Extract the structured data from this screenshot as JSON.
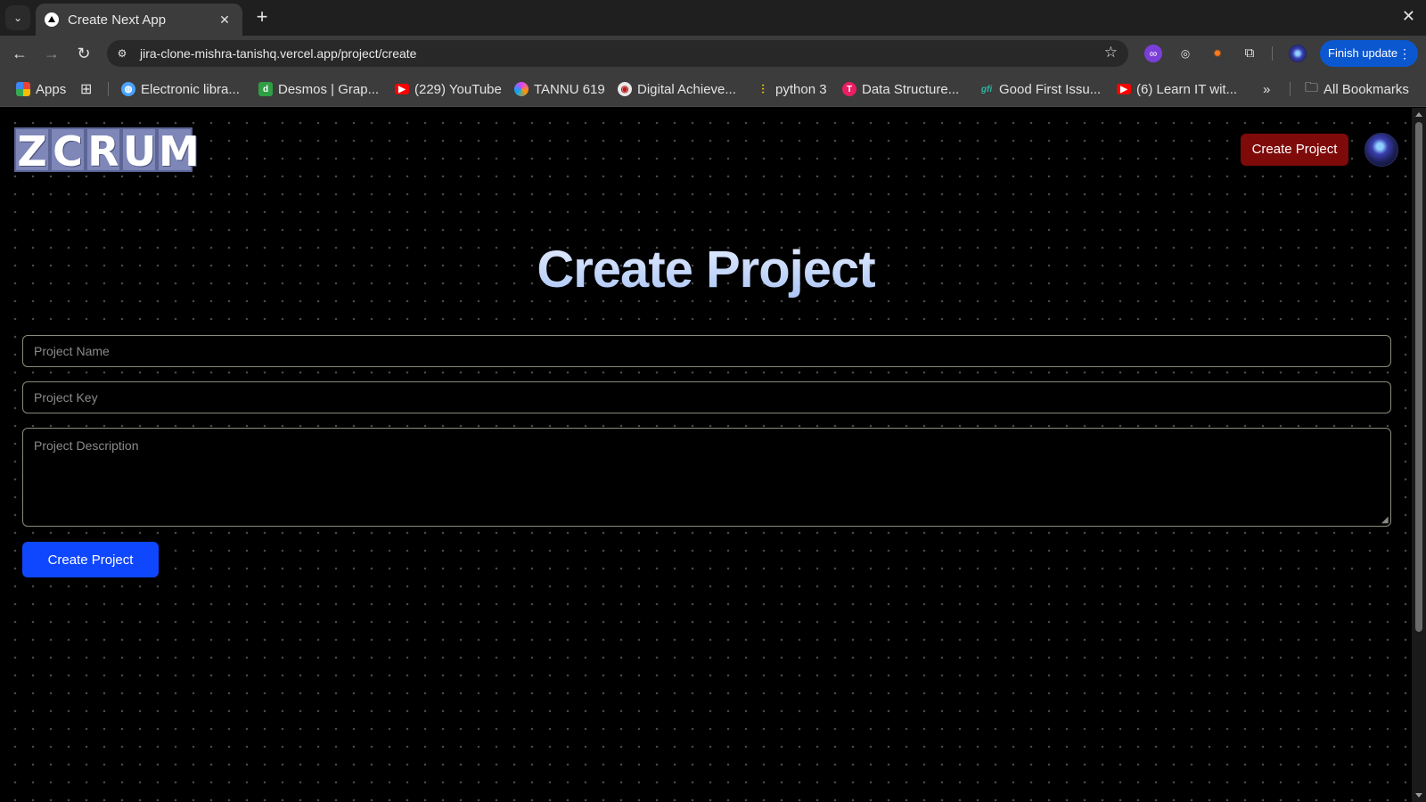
{
  "browser": {
    "tab_title": "Create Next App",
    "tab_close": "✕",
    "new_tab": "+",
    "window_close": "✕",
    "tab_search": "⌄",
    "url": "jira-clone-mishra-tanishq.vercel.app/project/create",
    "finish_update": "Finish update",
    "kebab": "⋮",
    "back": "←",
    "forward": "→",
    "reload": "↻",
    "star": "☆"
  },
  "bookmarks": {
    "apps": "Apps",
    "items": [
      {
        "label": "Electronic libra...",
        "icon": "globe-icon",
        "color": "#4aa3ff"
      },
      {
        "label": "Desmos | Grap...",
        "icon": "desmos-icon",
        "color": "#2f9e44"
      },
      {
        "label": "(229) YouTube",
        "icon": "youtube-icon",
        "color": "#ff0000"
      },
      {
        "label": "TANNU 619",
        "icon": "swirl-icon",
        "color": "#e040fb"
      },
      {
        "label": "Digital Achieve...",
        "icon": "badge-icon",
        "color": "#e8e8e8"
      },
      {
        "label": "python 3",
        "icon": "bars-icon",
        "color": "#f5c400"
      },
      {
        "label": "Data Structure...",
        "icon": "brand-icon",
        "color": "#e91e63"
      },
      {
        "label": "Good First Issu...",
        "icon": "gfi-icon",
        "color": "#2bb5a3"
      },
      {
        "label": "(6) Learn IT wit...",
        "icon": "youtube-icon",
        "color": "#ff0000"
      }
    ],
    "more": "»",
    "all_bookmarks": "All Bookmarks"
  },
  "header": {
    "logo_letters": [
      "Z",
      "C",
      "R",
      "U",
      "M"
    ],
    "create_button": "Create Project"
  },
  "form": {
    "title": "Create Project",
    "name_placeholder": "Project Name",
    "key_placeholder": "Project Key",
    "description_placeholder": "Project Description",
    "submit_label": "Create Project"
  },
  "colors": {
    "accent_blue": "#0f47ff",
    "header_button_red": "#7f0a0a",
    "logo_tile": "#7f87b9",
    "title_gradient": "#c9d9ff"
  }
}
